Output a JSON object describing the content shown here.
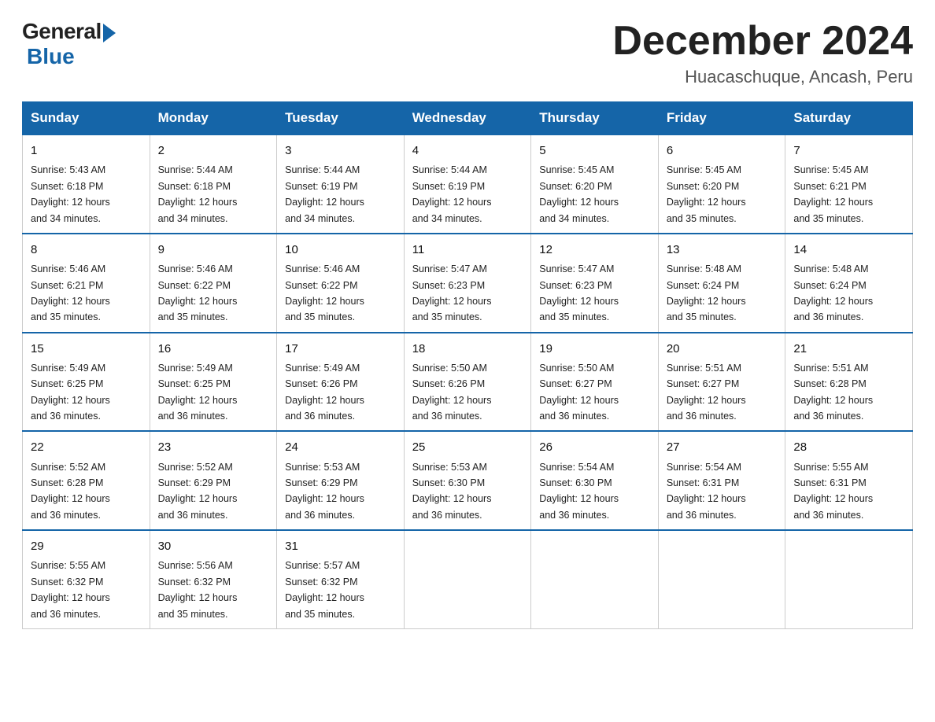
{
  "logo": {
    "general": "General",
    "arrow_color": "#1565a8",
    "blue": "Blue"
  },
  "title": {
    "month_year": "December 2024",
    "location": "Huacaschuque, Ancash, Peru"
  },
  "header_days": [
    "Sunday",
    "Monday",
    "Tuesday",
    "Wednesday",
    "Thursday",
    "Friday",
    "Saturday"
  ],
  "weeks": [
    [
      {
        "day": "1",
        "sunrise": "5:43 AM",
        "sunset": "6:18 PM",
        "daylight": "12 hours and 34 minutes."
      },
      {
        "day": "2",
        "sunrise": "5:44 AM",
        "sunset": "6:18 PM",
        "daylight": "12 hours and 34 minutes."
      },
      {
        "day": "3",
        "sunrise": "5:44 AM",
        "sunset": "6:19 PM",
        "daylight": "12 hours and 34 minutes."
      },
      {
        "day": "4",
        "sunrise": "5:44 AM",
        "sunset": "6:19 PM",
        "daylight": "12 hours and 34 minutes."
      },
      {
        "day": "5",
        "sunrise": "5:45 AM",
        "sunset": "6:20 PM",
        "daylight": "12 hours and 34 minutes."
      },
      {
        "day": "6",
        "sunrise": "5:45 AM",
        "sunset": "6:20 PM",
        "daylight": "12 hours and 35 minutes."
      },
      {
        "day": "7",
        "sunrise": "5:45 AM",
        "sunset": "6:21 PM",
        "daylight": "12 hours and 35 minutes."
      }
    ],
    [
      {
        "day": "8",
        "sunrise": "5:46 AM",
        "sunset": "6:21 PM",
        "daylight": "12 hours and 35 minutes."
      },
      {
        "day": "9",
        "sunrise": "5:46 AM",
        "sunset": "6:22 PM",
        "daylight": "12 hours and 35 minutes."
      },
      {
        "day": "10",
        "sunrise": "5:46 AM",
        "sunset": "6:22 PM",
        "daylight": "12 hours and 35 minutes."
      },
      {
        "day": "11",
        "sunrise": "5:47 AM",
        "sunset": "6:23 PM",
        "daylight": "12 hours and 35 minutes."
      },
      {
        "day": "12",
        "sunrise": "5:47 AM",
        "sunset": "6:23 PM",
        "daylight": "12 hours and 35 minutes."
      },
      {
        "day": "13",
        "sunrise": "5:48 AM",
        "sunset": "6:24 PM",
        "daylight": "12 hours and 35 minutes."
      },
      {
        "day": "14",
        "sunrise": "5:48 AM",
        "sunset": "6:24 PM",
        "daylight": "12 hours and 36 minutes."
      }
    ],
    [
      {
        "day": "15",
        "sunrise": "5:49 AM",
        "sunset": "6:25 PM",
        "daylight": "12 hours and 36 minutes."
      },
      {
        "day": "16",
        "sunrise": "5:49 AM",
        "sunset": "6:25 PM",
        "daylight": "12 hours and 36 minutes."
      },
      {
        "day": "17",
        "sunrise": "5:49 AM",
        "sunset": "6:26 PM",
        "daylight": "12 hours and 36 minutes."
      },
      {
        "day": "18",
        "sunrise": "5:50 AM",
        "sunset": "6:26 PM",
        "daylight": "12 hours and 36 minutes."
      },
      {
        "day": "19",
        "sunrise": "5:50 AM",
        "sunset": "6:27 PM",
        "daylight": "12 hours and 36 minutes."
      },
      {
        "day": "20",
        "sunrise": "5:51 AM",
        "sunset": "6:27 PM",
        "daylight": "12 hours and 36 minutes."
      },
      {
        "day": "21",
        "sunrise": "5:51 AM",
        "sunset": "6:28 PM",
        "daylight": "12 hours and 36 minutes."
      }
    ],
    [
      {
        "day": "22",
        "sunrise": "5:52 AM",
        "sunset": "6:28 PM",
        "daylight": "12 hours and 36 minutes."
      },
      {
        "day": "23",
        "sunrise": "5:52 AM",
        "sunset": "6:29 PM",
        "daylight": "12 hours and 36 minutes."
      },
      {
        "day": "24",
        "sunrise": "5:53 AM",
        "sunset": "6:29 PM",
        "daylight": "12 hours and 36 minutes."
      },
      {
        "day": "25",
        "sunrise": "5:53 AM",
        "sunset": "6:30 PM",
        "daylight": "12 hours and 36 minutes."
      },
      {
        "day": "26",
        "sunrise": "5:54 AM",
        "sunset": "6:30 PM",
        "daylight": "12 hours and 36 minutes."
      },
      {
        "day": "27",
        "sunrise": "5:54 AM",
        "sunset": "6:31 PM",
        "daylight": "12 hours and 36 minutes."
      },
      {
        "day": "28",
        "sunrise": "5:55 AM",
        "sunset": "6:31 PM",
        "daylight": "12 hours and 36 minutes."
      }
    ],
    [
      {
        "day": "29",
        "sunrise": "5:55 AM",
        "sunset": "6:32 PM",
        "daylight": "12 hours and 36 minutes."
      },
      {
        "day": "30",
        "sunrise": "5:56 AM",
        "sunset": "6:32 PM",
        "daylight": "12 hours and 35 minutes."
      },
      {
        "day": "31",
        "sunrise": "5:57 AM",
        "sunset": "6:32 PM",
        "daylight": "12 hours and 35 minutes."
      },
      null,
      null,
      null,
      null
    ]
  ],
  "labels": {
    "sunrise_prefix": "Sunrise: ",
    "sunset_prefix": "Sunset: ",
    "daylight_prefix": "Daylight: "
  }
}
